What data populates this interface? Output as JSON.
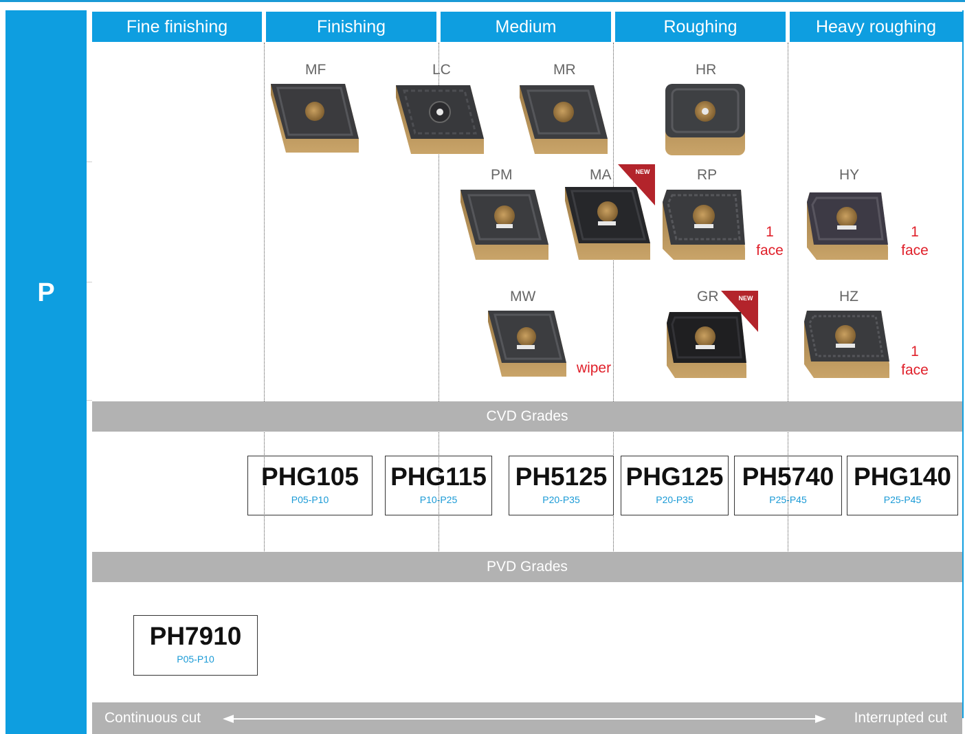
{
  "iso_group": "P",
  "headers": [
    "Fine finishing",
    "Finishing",
    "Medium",
    "Roughing",
    "Heavy roughing"
  ],
  "geometries": [
    {
      "code": "MF",
      "note": "",
      "badge": ""
    },
    {
      "code": "LC",
      "note": "",
      "badge": ""
    },
    {
      "code": "MR",
      "note": "",
      "badge": ""
    },
    {
      "code": "HR",
      "note": "",
      "badge": ""
    },
    {
      "code": "PM",
      "note": "",
      "badge": ""
    },
    {
      "code": "MA",
      "note": "",
      "badge": "NEW"
    },
    {
      "code": "RP",
      "note": "1 face",
      "badge": ""
    },
    {
      "code": "HY",
      "note": "1 face",
      "badge": ""
    },
    {
      "code": "MW",
      "note": "wiper",
      "badge": ""
    },
    {
      "code": "GR",
      "note": "",
      "badge": "NEW"
    },
    {
      "code": "HZ",
      "note": "1 face",
      "badge": ""
    }
  ],
  "cvd": {
    "title": "CVD Grades",
    "grades": [
      {
        "name": "PHG105",
        "range": "P05-P10"
      },
      {
        "name": "PHG115",
        "range": "P10-P25"
      },
      {
        "name": "PH5125",
        "range": "P20-P35"
      },
      {
        "name": "PHG125",
        "range": "P20-P35"
      },
      {
        "name": "PH5740",
        "range": "P25-P45"
      },
      {
        "name": "PHG140",
        "range": "P25-P45"
      }
    ]
  },
  "pvd": {
    "title": "PVD Grades",
    "grades": [
      {
        "name": "PH7910",
        "range": "P05-P10"
      }
    ]
  },
  "cut_scale": {
    "left": "Continuous cut",
    "right": "Interrupted cut"
  },
  "colors": {
    "brand_blue": "#0e9ee0",
    "band_gray": "#b2b2b2",
    "note_red": "#e0202a",
    "badge_red": "#b3242b",
    "range_blue": "#1a9ad6"
  }
}
